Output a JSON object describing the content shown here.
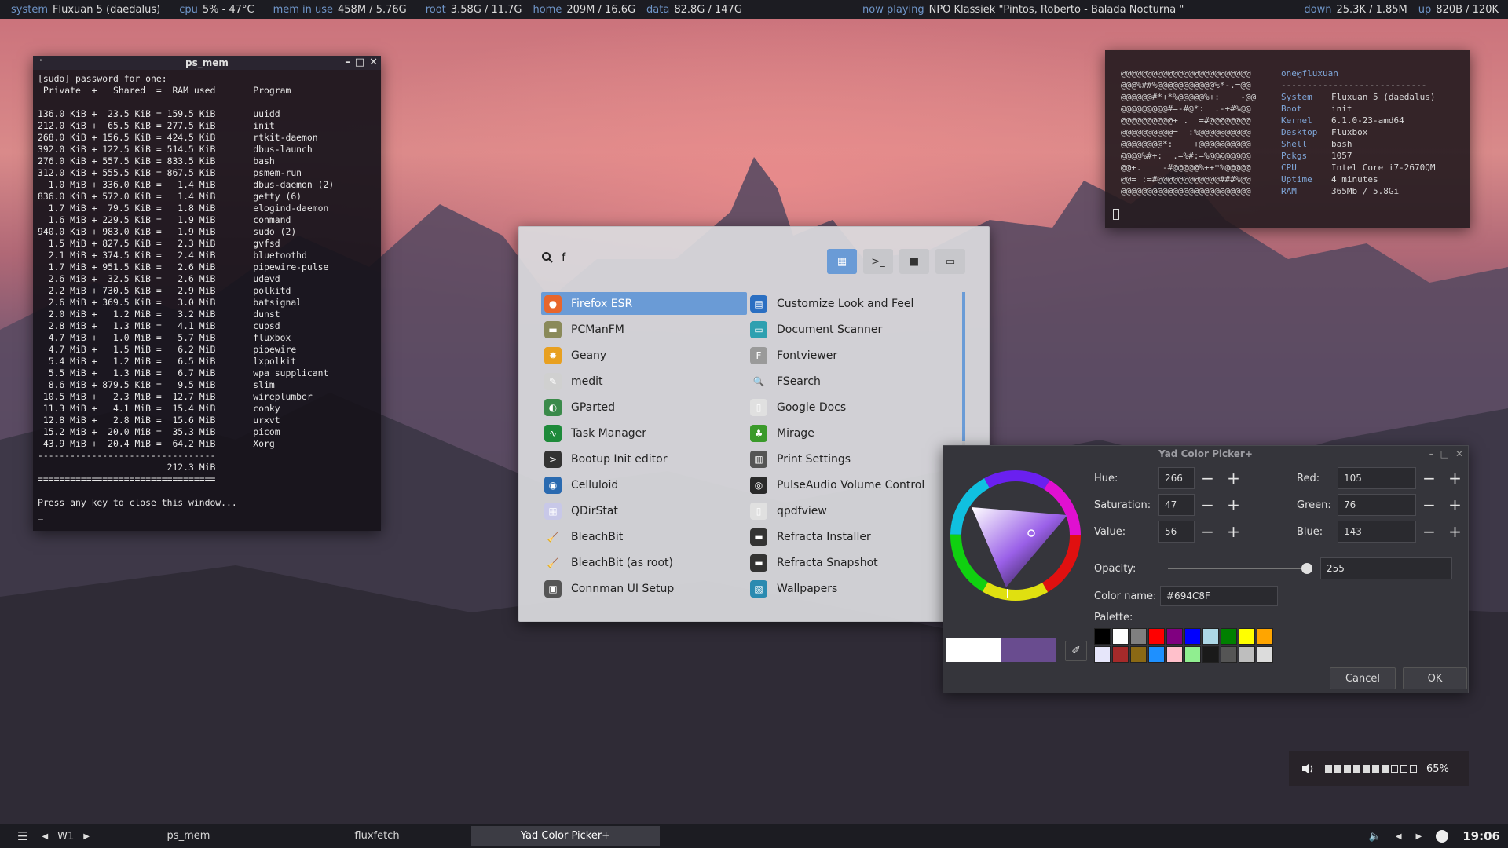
{
  "topbar": {
    "system_label": "system",
    "system_value": "Fluxuan 5 (daedalus)",
    "cpu_label": "cpu",
    "cpu_value": "5% - 47°C",
    "mem_label": "mem in use",
    "mem_value": "458M / 5.76G",
    "root_label": "root",
    "root_value": "3.58G / 11.7G",
    "home_label": "home",
    "home_value": "209M / 16.6G",
    "data_label": "data",
    "data_value": "82.8G / 147G",
    "np_label": "now playing",
    "np_value": "NPO Klassiek \"Pintos, Roberto - Balada Nocturna \"",
    "down_label": "down",
    "down_value": "25.3K / 1.85M",
    "up_label": "up",
    "up_value": "820B / 120K"
  },
  "psmem": {
    "title": "ps_mem",
    "title_dot": "·",
    "output": "[sudo] password for one:\n Private  +   Shared  =  RAM used       Program\n\n136.0 KiB +  23.5 KiB = 159.5 KiB       uuidd\n212.0 KiB +  65.5 KiB = 277.5 KiB       init\n268.0 KiB + 156.5 KiB = 424.5 KiB       rtkit-daemon\n392.0 KiB + 122.5 KiB = 514.5 KiB       dbus-launch\n276.0 KiB + 557.5 KiB = 833.5 KiB       bash\n312.0 KiB + 555.5 KiB = 867.5 KiB       psmem-run\n  1.0 MiB + 336.0 KiB =   1.4 MiB       dbus-daemon (2)\n836.0 KiB + 572.0 KiB =   1.4 MiB       getty (6)\n  1.7 MiB +  79.5 KiB =   1.8 MiB       elogind-daemon\n  1.6 MiB + 229.5 KiB =   1.9 MiB       conmand\n940.0 KiB + 983.0 KiB =   1.9 MiB       sudo (2)\n  1.5 MiB + 827.5 KiB =   2.3 MiB       gvfsd\n  2.1 MiB + 374.5 KiB =   2.4 MiB       bluetoothd\n  1.7 MiB + 951.5 KiB =   2.6 MiB       pipewire-pulse\n  2.6 MiB +  32.5 KiB =   2.6 MiB       udevd\n  2.2 MiB + 730.5 KiB =   2.9 MiB       polkitd\n  2.6 MiB + 369.5 KiB =   3.0 MiB       batsignal\n  2.0 MiB +   1.2 MiB =   3.2 MiB       dunst\n  2.8 MiB +   1.3 MiB =   4.1 MiB       cupsd\n  4.7 MiB +   1.0 MiB =   5.7 MiB       fluxbox\n  4.7 MiB +   1.5 MiB =   6.2 MiB       pipewire\n  5.4 MiB +   1.2 MiB =   6.5 MiB       lxpolkit\n  5.5 MiB +   1.3 MiB =   6.7 MiB       wpa_supplicant\n  8.6 MiB + 879.5 KiB =   9.5 MiB       slim\n 10.5 MiB +   2.3 MiB =  12.7 MiB       wireplumber\n 11.3 MiB +   4.1 MiB =  15.4 MiB       conky\n 12.8 MiB +   2.8 MiB =  15.6 MiB       urxvt\n 15.2 MiB +  20.0 MiB =  35.3 MiB       picom\n 43.9 MiB +  20.4 MiB =  64.2 MiB       Xorg\n---------------------------------\n                        212.3 MiB\n=================================\n\nPress any key to close this window...\n_"
  },
  "fetch": {
    "art": "@@@@@@@@@@@@@@@@@@@@@@@@@\n@@@%##%@@@@@@@@@@@%*-.=@@\n@@@@@@#*+*%@@@@@%+:    -@@\n@@@@@@@@@#=-#@*:  .-+#%@@\n@@@@@@@@@@+ .  =#@@@@@@@@\n@@@@@@@@@@=  :%@@@@@@@@@@\n@@@@@@@@*:    +@@@@@@@@@@\n@@@@%#+:  .=%#:=%@@@@@@@@\n@@+.    -#@@@@@%++*%@@@@@\n@@= :=#@@@@@@@@@@@@###%@@\n@@@@@@@@@@@@@@@@@@@@@@@@@",
    "user_host": "one@fluxuan",
    "separator": "----------------------------",
    "rows": [
      {
        "k": "System",
        "v": "Fluxuan 5 (daedalus)"
      },
      {
        "k": "Boot",
        "v": "init"
      },
      {
        "k": "Kernel",
        "v": "6.1.0-23-amd64"
      },
      {
        "k": "Desktop",
        "v": "Fluxbox"
      },
      {
        "k": "Shell",
        "v": "bash"
      },
      {
        "k": "Pckgs",
        "v": "1057"
      },
      {
        "k": "CPU",
        "v": "Intel Core i7-2670QM"
      },
      {
        "k": "Uptime",
        "v": "4 minutes"
      },
      {
        "k": "RAM",
        "v": "365Mb / 5.8Gi"
      }
    ]
  },
  "launcher": {
    "search_value": "f",
    "apps": [
      {
        "label": "Firefox ESR",
        "icon": "firefox-icon",
        "color": "#e8662c",
        "glyph": "●",
        "selected": true
      },
      {
        "label": "Customize Look and Feel",
        "icon": "appearance-icon",
        "color": "#2b6fc2",
        "glyph": "▤"
      },
      {
        "label": "PCManFM",
        "icon": "file-manager-icon",
        "color": "#8a8a5a",
        "glyph": "▬"
      },
      {
        "label": "Document Scanner",
        "icon": "scanner-icon",
        "color": "#2ea0b0",
        "glyph": "▭"
      },
      {
        "label": "Geany",
        "icon": "geany-icon",
        "color": "#e8a020",
        "glyph": "✹"
      },
      {
        "label": "Fontviewer",
        "icon": "font-icon",
        "color": "#9a9a9a",
        "glyph": "F"
      },
      {
        "label": "medit",
        "icon": "medit-icon",
        "color": "#d0d0d0",
        "glyph": "✎"
      },
      {
        "label": "FSearch",
        "icon": "search-app-icon",
        "color": "transparent",
        "glyph": "🔍"
      },
      {
        "label": "GParted",
        "icon": "gparted-icon",
        "color": "#3a8a4a",
        "glyph": "◐"
      },
      {
        "label": "Google Docs",
        "icon": "web-doc-icon",
        "color": "#e0e0e0",
        "glyph": "▯"
      },
      {
        "label": "Task Manager",
        "icon": "task-manager-icon",
        "color": "#1e8a3a",
        "glyph": "∿"
      },
      {
        "label": "Mirage",
        "icon": "mirage-icon",
        "color": "#3a9a2a",
        "glyph": "♣"
      },
      {
        "label": "Bootup Init editor",
        "icon": "terminal-icon",
        "color": "#333333",
        "glyph": ">"
      },
      {
        "label": "Print Settings",
        "icon": "printer-icon",
        "color": "#555555",
        "glyph": "▥"
      },
      {
        "label": "Celluloid",
        "icon": "celluloid-icon",
        "color": "#2a6ab0",
        "glyph": "◉"
      },
      {
        "label": "PulseAudio Volume Control",
        "icon": "volume-control-icon",
        "color": "#2a2a2a",
        "glyph": "◎"
      },
      {
        "label": "QDirStat",
        "icon": "qdirstat-icon",
        "color": "#c8c8e8",
        "glyph": "▦"
      },
      {
        "label": "qpdfview",
        "icon": "pdf-icon",
        "color": "#e0e0e0",
        "glyph": "▯"
      },
      {
        "label": "BleachBit",
        "icon": "bleachbit-icon",
        "color": "transparent",
        "glyph": "🧹"
      },
      {
        "label": "Refracta Installer",
        "icon": "installer-icon",
        "color": "#333333",
        "glyph": "▬"
      },
      {
        "label": "BleachBit (as root)",
        "icon": "bleachbit-root-icon",
        "color": "transparent",
        "glyph": "🧹"
      },
      {
        "label": "Refracta Snapshot",
        "icon": "snapshot-icon",
        "color": "#333333",
        "glyph": "▬"
      },
      {
        "label": "Connman UI Setup",
        "icon": "network-icon",
        "color": "#555555",
        "glyph": "▣"
      },
      {
        "label": "Wallpapers",
        "icon": "wallpaper-icon",
        "color": "#2a8ab0",
        "glyph": "▨"
      }
    ]
  },
  "yad": {
    "title": "Yad Color Picker+",
    "hue_label": "Hue:",
    "hue": "266",
    "sat_label": "Saturation:",
    "sat": "47",
    "val_label": "Value:",
    "val": "56",
    "red_label": "Red:",
    "red": "105",
    "green_label": "Green:",
    "green": "76",
    "blue_label": "Blue:",
    "blue": "143",
    "opacity_label": "Opacity:",
    "opacity": "255",
    "opacity_fraction": 1.0,
    "colorname_label": "Color name:",
    "colorname": "#694C8F",
    "palette_label": "Palette:",
    "current_color": "#694C8F",
    "previous_color": "#FFFFFF",
    "palette": [
      "#000000",
      "#FFFFFF",
      "#7F7F7F",
      "#FF0000",
      "#800080",
      "#0000FF",
      "#ADD8E6",
      "#008000",
      "#FFFF00",
      "#FFA500",
      "#E6E6FA",
      "#A52A2A",
      "#8B6914",
      "#1E90FF",
      "#FFC0CB",
      "#90EE90",
      "#1A1A1A",
      "#555555",
      "#BEBEBE",
      "#DCDCDC"
    ],
    "cancel_label": "Cancel",
    "ok_label": "OK"
  },
  "osd": {
    "percent_label": "65%",
    "level": 0.65,
    "segments": 10,
    "filled": 7
  },
  "taskbar": {
    "workspace": "W1",
    "tasks": [
      {
        "label": "ps_mem",
        "active": false
      },
      {
        "label": "fluxfetch",
        "active": false
      },
      {
        "label": "Yad Color Picker+",
        "active": true
      }
    ],
    "clock": "19:06"
  }
}
